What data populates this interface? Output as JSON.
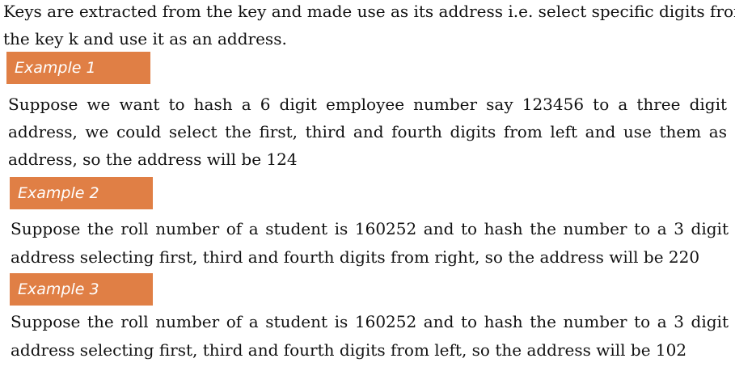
{
  "intro": {
    "line1": "Keys are extracted from the key and made use as its address i.e. select specific digits from",
    "line2": "the key k and use it as an address."
  },
  "examples": [
    {
      "heading": "Example 1",
      "lines": [
        "Suppose we want to hash a 6 digit employee number say 123456 to a three digit",
        "address, we could select the first, third and fourth digits from left and use them as",
        "address, so the address will be 124"
      ]
    },
    {
      "heading": "Example 2",
      "lines": [
        "Suppose the roll number of a student is 160252 and to hash the number to a 3 digit",
        "address selecting first, third and fourth digits from right, so the address will be 220"
      ]
    },
    {
      "heading": "Example 3",
      "lines": [
        "Suppose the roll number of a student is 160252 and to hash the number to a 3 digit",
        "address selecting first, third and fourth digits from left, so the address will be 102"
      ]
    }
  ],
  "colors": {
    "banner_background": "#e07f45",
    "banner_text": "#ffffff",
    "body_text": "#111111"
  }
}
